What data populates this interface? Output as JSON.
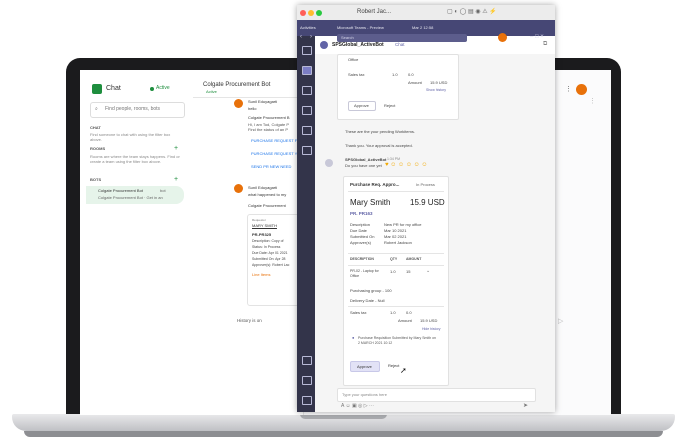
{
  "google_chat": {
    "app_name": "Chat",
    "status": "Active",
    "search_placeholder": "Find people, rooms, bots",
    "section_chat": "CHAT",
    "chat_empty": "Find someone to chat with using the filter box above.",
    "section_rooms": "ROOMS",
    "rooms_empty": "Rooms are where the team stays happens. Find or create a team using the filter box above.",
    "section_bots": "BOTS",
    "bot_name": "Colgate Procurement Bot",
    "bot_tag": "bot",
    "bot_sub": "Colgate Procurement Bot · Get in an",
    "conv_title": "Colgate Procurement Bot",
    "conv_status": "Active",
    "msg1_sender": "Sunil Eduyagarti",
    "msg1_text": "hello",
    "bot_reply": "Colgate Procurement B",
    "bot_greet1": "Hi, I am Tod, Colgate P",
    "bot_greet2": "Find the status of an P",
    "link1": "PURCHASE REQUEST F",
    "link2": "PURCHASE REQUEST Y",
    "link3": "SEND PR NEW NEED",
    "msg2_sender": "Sunil Eduyagarti",
    "msg2_text": "what happened to my",
    "bot_reply2": "Colgate Procurement",
    "req_label": "Requestor",
    "req_name": "MARY SMITH",
    "pr_id": "PR-PR325",
    "desc": "Description: Copy of",
    "status_line": "Status: In Process",
    "due": "Due Date: Apr 01 2021",
    "submitted": "Submitted On: Apr 28",
    "approver": "Approver(s): Robert Lac",
    "line_items": "Line Items",
    "history": "History is on"
  },
  "teams": {
    "mac_app": "Activities",
    "window_title": "Microsoft Teams - Preview",
    "menu_date": "Mar 2 12:58",
    "user_name": "Robert Jac...",
    "search_placeholder": "Search",
    "chat_title": "SPSGlobal_ActiveBot",
    "chat_tab": "Chat",
    "top_card": {
      "office": "Office",
      "sales_tax": "Sales tax",
      "qty": "1.0",
      "tax_val": "0.0",
      "amount_label": "Amount",
      "amount": "15.9 USD",
      "show_history": "Show history",
      "approve": "Approve",
      "reject": "Reject"
    },
    "msg_pending": "These are the your pending Workitems.",
    "msg_thanks": "Thank you. Your approval is accepted.",
    "bot_sender": "SPSGlobal_ActiveBot",
    "bot_time": "1:34 PM",
    "bot_line": "Do you have one yet",
    "card": {
      "title": "Purchase Req. Appro...",
      "state": "In Process",
      "requester": "Mary Smith",
      "total": "15.9 USD",
      "pr": "PR. PR163",
      "desc_label": "Description",
      "desc_val": "New PR for my office",
      "due_label": "Due Date",
      "due_val": "Mar 10 2021",
      "sub_label": "Submitted On",
      "sub_val": "Mar 02 2021",
      "appr_label": "Approver(s)",
      "appr_val": "Robert Jackson",
      "col_desc": "DESCRIPTION",
      "col_qty": "QTY",
      "col_amt": "AMOUNT",
      "item_name": "PR-02 - Laptop for Office",
      "item_qty": "1.0",
      "item_amt": "15",
      "purch_group": "Purchasing group - 100",
      "delivery": "Delivery Date - Null",
      "sales_tax": "Sales tax",
      "tax_qty": "1.0",
      "tax_val": "0.0",
      "amount_label": "Amount",
      "amount": "15.9 USD",
      "hide_history": "Hide history",
      "history_text": "Purchase Requisition Submitted by Mary Smith on 2 MARCH 2021 10:12",
      "approve": "Approve",
      "reject": "Reject"
    },
    "compose_placeholder": "Type your questions here"
  }
}
